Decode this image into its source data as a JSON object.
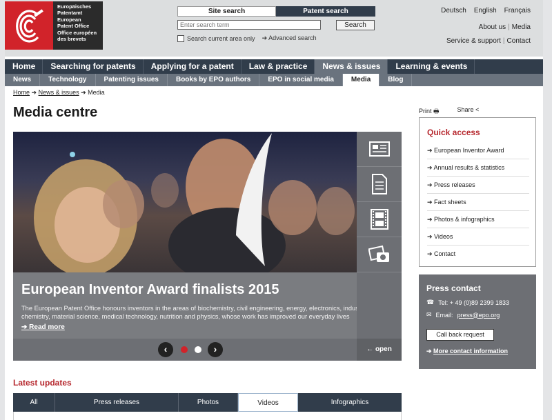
{
  "logo": {
    "lines": [
      "Europäisches",
      "Patentamt",
      "European",
      "Patent Office",
      "Office européen",
      "des brevets"
    ]
  },
  "search": {
    "tab_site": "Site search",
    "tab_patent": "Patent search",
    "placeholder": "Enter search term",
    "button": "Search",
    "current_area": "Search current area only",
    "advanced": "Advanced search"
  },
  "languages": [
    "Deutsch",
    "English",
    "Français"
  ],
  "toplinks": {
    "about": "About us",
    "media": "Media",
    "service": "Service & support",
    "contact": "Contact"
  },
  "mainnav": [
    {
      "label": "Home",
      "active": false
    },
    {
      "label": "Searching for patents",
      "active": false
    },
    {
      "label": "Applying for a patent",
      "active": false
    },
    {
      "label": "Law & practice",
      "active": false
    },
    {
      "label": "News & issues",
      "active": true
    },
    {
      "label": "Learning & events",
      "active": false
    }
  ],
  "subnav": [
    {
      "label": "News",
      "active": false
    },
    {
      "label": "Technology",
      "active": false
    },
    {
      "label": "Patenting issues",
      "active": false
    },
    {
      "label": "Books by EPO authors",
      "active": false
    },
    {
      "label": "EPO in social media",
      "active": false
    },
    {
      "label": "Media",
      "active": true
    },
    {
      "label": "Blog",
      "active": false
    }
  ],
  "breadcrumb": {
    "home": "Home",
    "news": "News & issues",
    "current": "Media"
  },
  "page_title": "Media centre",
  "hero": {
    "title": "European Inventor Award finalists 2015",
    "description": "The European Patent Office honours inventors in the areas of biochemistry, civil engineering, energy, electronics, industrial chemistry, material science, medical technology, nutrition and physics, whose work has improved our everyday lives",
    "read_more": "Read more",
    "open_label": "open"
  },
  "latest": {
    "title": "Latest updates",
    "tabs": [
      "All",
      "Press releases",
      "Photos",
      "Videos",
      "Infographics"
    ],
    "active_tab": "Videos"
  },
  "tools": {
    "print": "Print",
    "share": "Share"
  },
  "quick_access": {
    "title": "Quick access",
    "items": [
      "European Inventor Award",
      "Annual results & statistics",
      "Press releases",
      "Fact sheets",
      "Photos & infographics",
      "Videos",
      "Contact"
    ]
  },
  "press_contact": {
    "title": "Press contact",
    "tel": "Tel: + 49 (0)89 2399 1833",
    "email_label": "Email:",
    "email": "press@epo.org",
    "callback": "Call back request",
    "more": "More contact information"
  },
  "colors": {
    "brand_red": "#d1232a",
    "nav_dark": "#313d4b",
    "nav_grey": "#6a737e",
    "accent_red_text": "#b6282e"
  }
}
